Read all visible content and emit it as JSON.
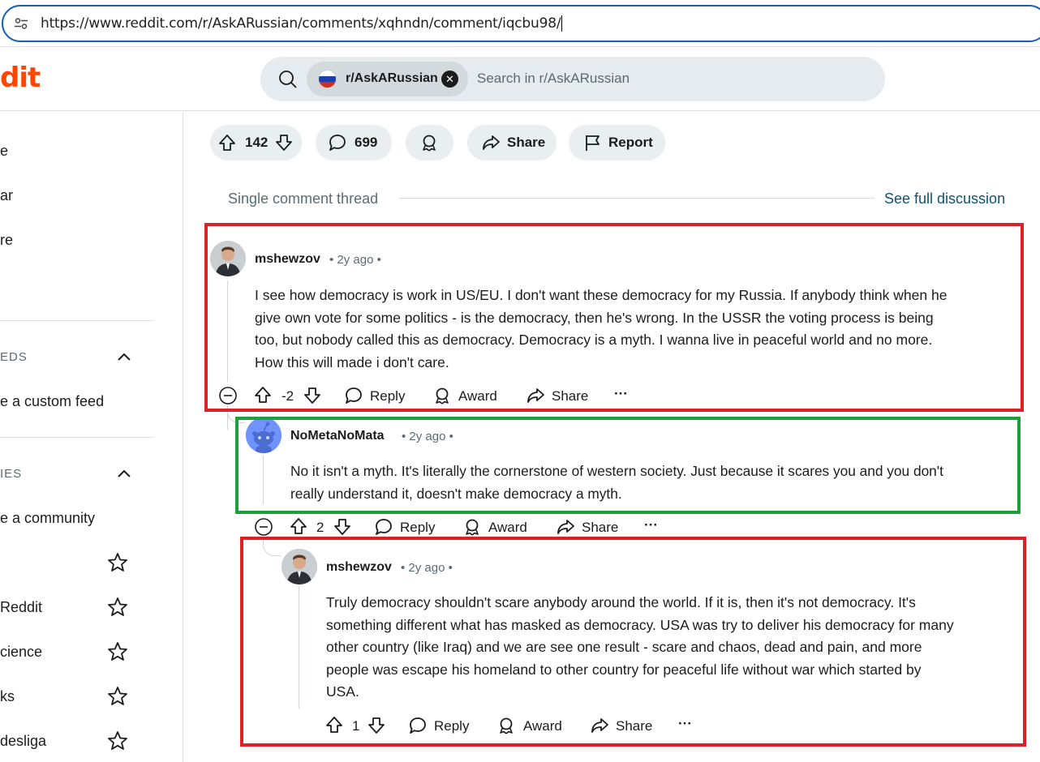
{
  "browser": {
    "url": "https://www.reddit.com/r/AskARussian/comments/xqhndn/comment/iqcbu98/"
  },
  "header": {
    "logo_text": "dit",
    "subreddit_chip": "r/AskARussian",
    "search_placeholder": "Search in r/AskARussian"
  },
  "sidebar": {
    "items": [
      {
        "label": "e"
      },
      {
        "label": "ar"
      },
      {
        "label": "re"
      }
    ],
    "feeds_heading": "EDS",
    "create_feed": "e a custom feed",
    "communities_heading": "IES",
    "create_community": "e a community",
    "communities": [
      {
        "label": ""
      },
      {
        "label": "Reddit"
      },
      {
        "label": "cience"
      },
      {
        "label": "ks"
      },
      {
        "label": "desliga"
      }
    ]
  },
  "post_actions": {
    "votes": "142",
    "comments": "699",
    "share": "Share",
    "report": "Report"
  },
  "thread": {
    "label": "Single comment thread",
    "see_full": "See full discussion"
  },
  "comments": [
    {
      "author": "mshewzov",
      "time": "• 2y ago •",
      "lines": [
        "I see how democracy is work in US/EU. I don't want these democracy for my Russia. If anybody think when he",
        "give own vote for some politics - is the democracy, then he's wrong. In the USSR the voting process is being",
        "too, but nobody called this as democracy. Democracy is a myth. I wanna live in peaceful world and no more.",
        "How this will made i don't care."
      ],
      "score": "-2",
      "reply": "Reply",
      "award": "Award",
      "share": "Share",
      "more": "···"
    },
    {
      "author": "NoMetaNoMata",
      "time": "• 2y ago •",
      "lines": [
        "No it isn't a myth. It's literally the cornerstone of western society. Just because it scares you and you don't",
        "really understand it, doesn't make democracy a myth."
      ],
      "score": "2",
      "reply": "Reply",
      "award": "Award",
      "share": "Share",
      "more": "···"
    },
    {
      "author": "mshewzov",
      "time": "• 2y ago •",
      "lines": [
        "Truly democracy shouldn't scare anybody around the world. If it is, then it's not democracy. It's",
        "something different what has masked as democracy. USA was try to deliver his democracy for many",
        "other country (like Iraq) and we are see one result - scare and chaos, dead and pain, and more",
        "people was escape his homeland to other country for peaceful life without war which started by",
        "USA."
      ],
      "score": "1",
      "reply": "Reply",
      "award": "Award",
      "share": "Share",
      "more": "···"
    }
  ],
  "colors": {
    "highlight_red": "#dd2124",
    "highlight_green": "#1f9e3e",
    "reddit_orange": "#ff4500",
    "link_blue": "#0e5274"
  }
}
